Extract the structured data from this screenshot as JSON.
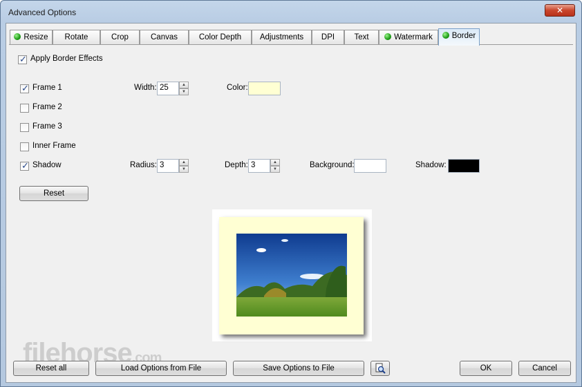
{
  "window": {
    "title": "Advanced Options",
    "close_glyph": "✕"
  },
  "tabs": [
    {
      "label": "Resize",
      "has_dot": true
    },
    {
      "label": "Rotate",
      "has_dot": false
    },
    {
      "label": "Crop",
      "has_dot": false
    },
    {
      "label": "Canvas",
      "has_dot": false
    },
    {
      "label": "Color Depth",
      "has_dot": false
    },
    {
      "label": "Adjustments",
      "has_dot": false
    },
    {
      "label": "DPI",
      "has_dot": false
    },
    {
      "label": "Text",
      "has_dot": false
    },
    {
      "label": "Watermark",
      "has_dot": true
    },
    {
      "label": "Border",
      "has_dot": true,
      "active": true
    }
  ],
  "border": {
    "apply_label": "Apply Border Effects",
    "apply_checked": true,
    "frame1": {
      "label": "Frame 1",
      "checked": true
    },
    "frame2": {
      "label": "Frame 2",
      "checked": false
    },
    "frame3": {
      "label": "Frame 3",
      "checked": false
    },
    "inner_frame": {
      "label": "Inner Frame",
      "checked": false
    },
    "shadow": {
      "label": "Shadow",
      "checked": true
    },
    "width_label": "Width:",
    "width_value": "25",
    "color_label": "Color:",
    "color_value": "#ffffd3",
    "radius_label": "Radius:",
    "radius_value": "3",
    "depth_label": "Depth:",
    "depth_value": "3",
    "background_label": "Background:",
    "background_value": "#ffffff",
    "shadow_color_label": "Shadow:",
    "shadow_color_value": "#000000",
    "reset_label": "Reset"
  },
  "footer": {
    "reset_all": "Reset all",
    "load": "Load Options from File",
    "save": "Save Options to File",
    "preview_icon": "magnifier-document-icon",
    "ok": "OK",
    "cancel": "Cancel"
  },
  "watermark_text": "filehorse",
  "watermark_suffix": ".com",
  "check_glyph": "✓",
  "spin_up": "▲",
  "spin_down": "▼"
}
